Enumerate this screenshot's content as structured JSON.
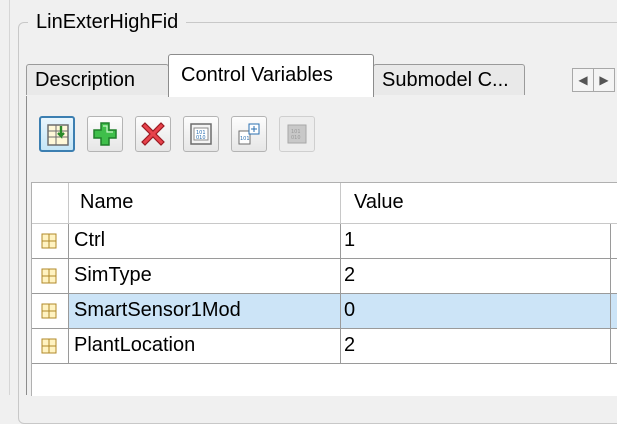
{
  "group": {
    "title": "LinExterHighFid"
  },
  "tabs": [
    {
      "label": "Description",
      "active": false
    },
    {
      "label": "Control Variables",
      "active": true
    },
    {
      "label": "Submodel C...",
      "active": false
    }
  ],
  "tab_scroll": {
    "left_icon": "scroll-left-icon",
    "right_icon": "scroll-right-icon"
  },
  "toolbar": [
    {
      "name": "import-variables-button",
      "icon": "import-icon"
    },
    {
      "name": "add-variable-button",
      "icon": "plus-icon"
    },
    {
      "name": "delete-variable-button",
      "icon": "delete-x-icon"
    },
    {
      "name": "variable-list-button",
      "icon": "list-values-icon"
    },
    {
      "name": "expand-structure-button",
      "icon": "structure-icon"
    },
    {
      "name": "export-variables-button",
      "icon": "export-icon",
      "disabled": true
    }
  ],
  "table": {
    "columns": {
      "name": "Name",
      "value": "Value"
    },
    "rows": [
      {
        "name": "Ctrl",
        "value": "1"
      },
      {
        "name": "SimType",
        "value": "2"
      },
      {
        "name": "SmartSensor1Mod",
        "value": "0",
        "selected": true
      },
      {
        "name": "PlantLocation",
        "value": "2"
      }
    ]
  },
  "colors": {
    "selected_row": "#cce4f7",
    "plus_green": "#2aa13a",
    "delete_red": "#d9303a",
    "highlight_blue": "#3c7fb1"
  }
}
